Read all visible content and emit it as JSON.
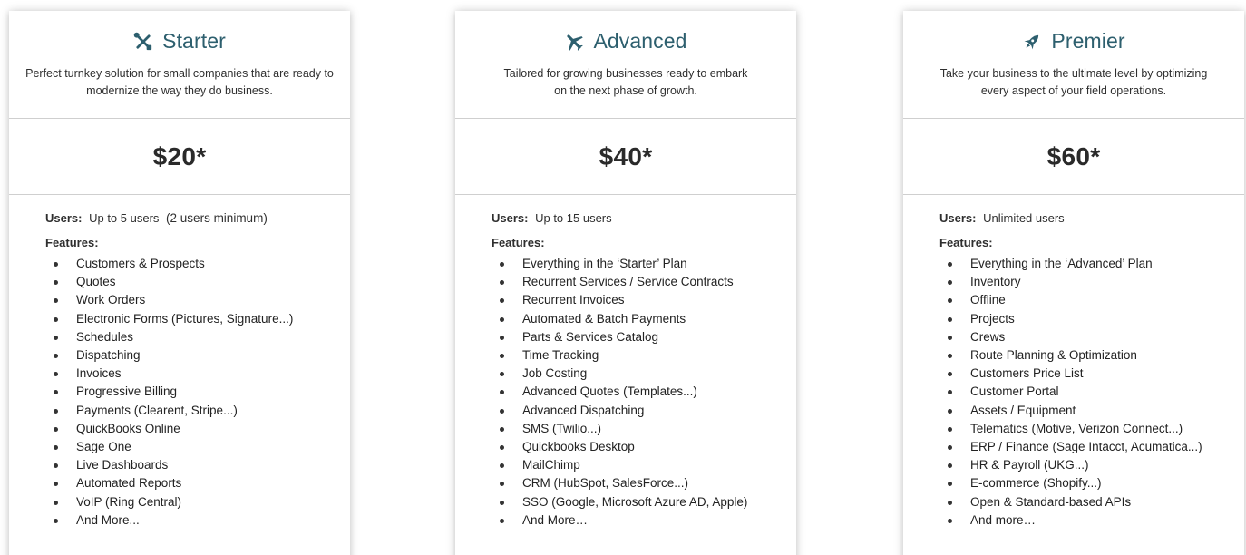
{
  "accent_color": "#2d5f6e",
  "plans": [
    {
      "icon": "tools-icon",
      "title": "Starter",
      "description": "Perfect turnkey solution for small companies that are ready to modernize the way they do business.",
      "price": "$20*",
      "users_label": "Users:",
      "users_value": "Up to 5 users",
      "users_extra": "(2 users minimum)",
      "features_label": "Features:",
      "features": [
        "Customers & Prospects",
        "Quotes",
        "Work Orders",
        "Electronic Forms (Pictures, Signature...)",
        "Schedules",
        "Dispatching",
        "Invoices",
        "Progressive Billing",
        "Payments (Clearent, Stripe...)",
        "QuickBooks Online",
        "Sage One",
        "Live Dashboards",
        "Automated Reports",
        "VoIP (Ring Central)",
        "And More..."
      ]
    },
    {
      "icon": "airplane-icon",
      "title": "Advanced",
      "description": "Tailored for growing businesses ready to embark on the next phase of growth.",
      "price": "$40*",
      "users_label": "Users:",
      "users_value": "Up to 15 users",
      "users_extra": "",
      "features_label": "Features:",
      "features": [
        "Everything in the ‘Starter’ Plan",
        "Recurrent Services / Service Contracts",
        "Recurrent Invoices",
        "Automated & Batch Payments",
        "Parts & Services Catalog",
        "Time Tracking",
        "Job Costing",
        "Advanced Quotes (Templates...)",
        "Advanced Dispatching",
        "SMS (Twilio...)",
        "Quickbooks Desktop",
        "MailChimp",
        "CRM (HubSpot, SalesForce...)",
        "SSO (Google, Microsoft Azure AD, Apple)",
        "And More…"
      ]
    },
    {
      "icon": "rocket-icon",
      "title": "Premier",
      "description": "Take your business to the ultimate level by optimizing every aspect of your field operations.",
      "price": "$60*",
      "users_label": "Users:",
      "users_value": "Unlimited users",
      "users_extra": "",
      "features_label": "Features:",
      "features": [
        "Everything in the ‘Advanced’ Plan",
        "Inventory",
        "Offline",
        "Projects",
        "Crews",
        "Route Planning & Optimization",
        "Customers Price List",
        "Customer Portal",
        "Assets / Equipment",
        "Telematics (Motive, Verizon Connect...)",
        "ERP / Finance (Sage Intacct, Acumatica...)",
        "HR & Payroll (UKG...)",
        "E-commerce (Shopify...)",
        "Open & Standard-based APIs",
        "And more…"
      ]
    }
  ]
}
